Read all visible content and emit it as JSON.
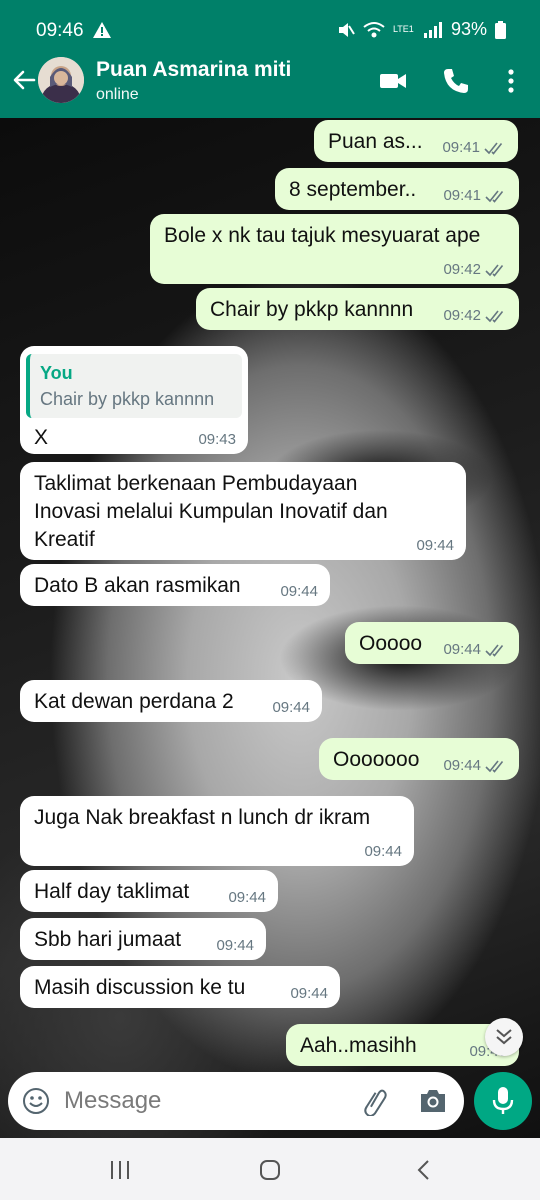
{
  "status_bar": {
    "time": "09:46",
    "battery": "93%",
    "network": "LTE1"
  },
  "header": {
    "contact_name": "Puan Asmarina miti",
    "contact_status": "online",
    "icons": [
      "back-arrow-icon",
      "video-call-icon",
      "phone-icon",
      "more-vert-icon"
    ]
  },
  "messages": [
    {
      "dir": "out",
      "text": "Puan as...",
      "time": "09:41"
    },
    {
      "dir": "out",
      "text": "8 september..",
      "time": "09:41"
    },
    {
      "dir": "out",
      "text": "Bole x nk tau tajuk mesyuarat ape",
      "time": "09:42"
    },
    {
      "dir": "out",
      "text": "Chair by pkkp kannnn",
      "time": "09:42"
    },
    {
      "dir": "in",
      "quote_author": "You",
      "quote_text": "Chair by pkkp kannnn",
      "text": "X",
      "time": "09:43"
    },
    {
      "dir": "in",
      "text_lines": [
        "Taklimat berkenaan Pembudayaan",
        "Inovasi melalui Kumpulan Inovatif dan",
        "Kreatif"
      ],
      "time": "09:44"
    },
    {
      "dir": "in",
      "text": "Dato B akan rasmikan",
      "time": "09:44"
    },
    {
      "dir": "out",
      "text": "Ooooo",
      "time": "09:44"
    },
    {
      "dir": "in",
      "text": "Kat dewan perdana 2",
      "time": "09:44"
    },
    {
      "dir": "out",
      "text": "Ooooooo",
      "time": "09:44"
    },
    {
      "dir": "in",
      "text": "Juga Nak breakfast n lunch dr ikram",
      "time": "09:44"
    },
    {
      "dir": "in",
      "text": "Half day taklimat",
      "time": "09:44"
    },
    {
      "dir": "in",
      "text": "Sbb hari jumaat",
      "time": "09:44"
    },
    {
      "dir": "in",
      "text": "Masih discussion ke tu",
      "time": "09:44"
    },
    {
      "dir": "out",
      "text": "Aah..masihh",
      "time": "09:45"
    }
  ],
  "composer": {
    "placeholder": "Message"
  },
  "colors": {
    "header": "#008069",
    "outgoing_bubble": "#e7fdd6",
    "incoming_bubble": "#ffffff",
    "accent": "#00a884",
    "tick": "#667781"
  }
}
